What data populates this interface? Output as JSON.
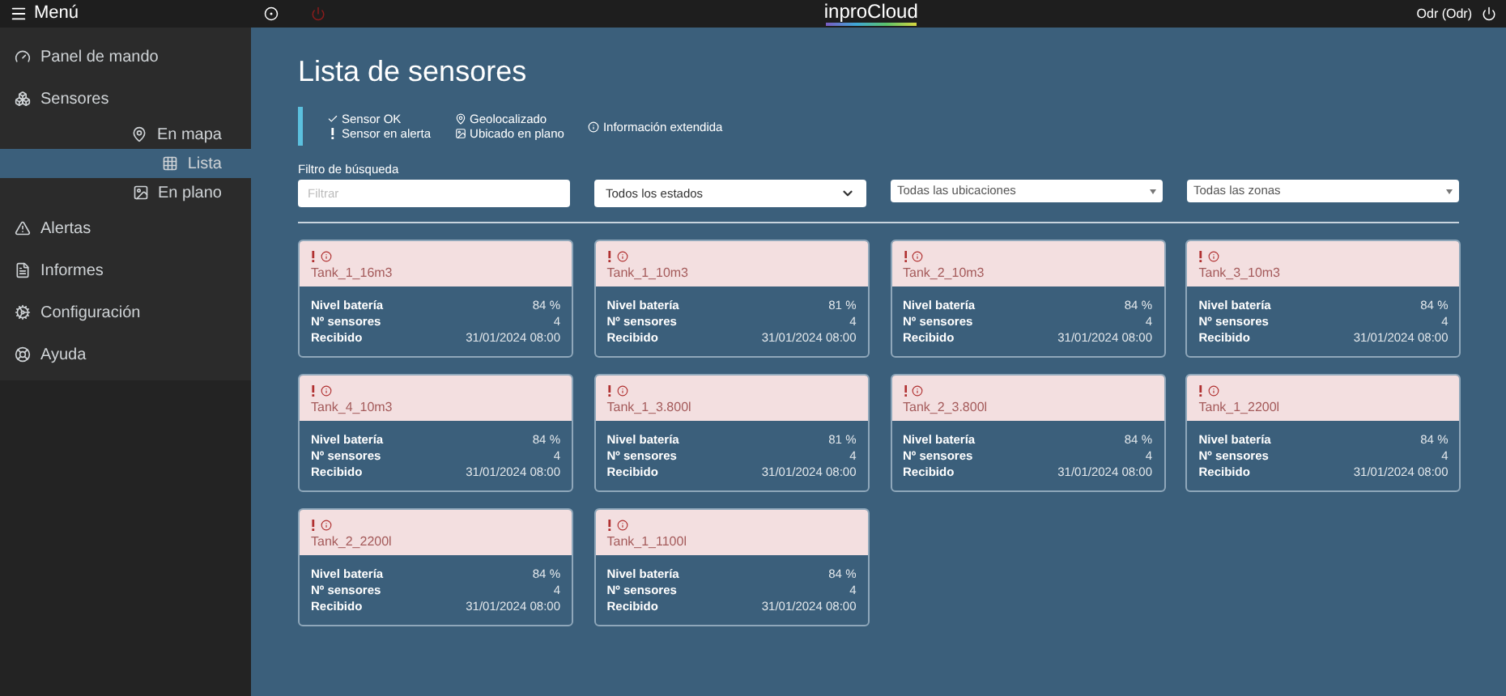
{
  "topbar": {
    "menu_label": "Menú",
    "logo": "inproCloud",
    "user": "Odr (Odr)"
  },
  "sidebar": {
    "items": [
      {
        "label": "Panel de mando",
        "selected": false
      },
      {
        "label": "Sensores",
        "selected": false,
        "children": [
          {
            "label": "En mapa",
            "selected": false
          },
          {
            "label": "Lista",
            "selected": true
          },
          {
            "label": "En plano",
            "selected": false
          }
        ]
      },
      {
        "label": "Alertas",
        "selected": false
      },
      {
        "label": "Informes",
        "selected": false
      },
      {
        "label": "Configuración",
        "selected": false
      },
      {
        "label": "Ayuda",
        "selected": false
      }
    ]
  },
  "page_title": "Lista de sensores",
  "legend": [
    [
      "Sensor OK",
      "Sensor en alerta"
    ],
    [
      "Geolocalizado",
      "Ubicado en plano"
    ],
    [
      "Información extendida"
    ]
  ],
  "filters": {
    "label": "Filtro de búsqueda",
    "search_placeholder": "Filtrar",
    "selects": [
      {
        "value": "Todos los estados",
        "kind": "native"
      },
      {
        "value": "Todas las ubicaciones",
        "kind": "custom"
      },
      {
        "value": "Todas las zonas",
        "kind": "custom"
      }
    ]
  },
  "sensors": [
    {
      "name": "Tank_1_16m3",
      "alert": true,
      "info": true,
      "rows": [
        [
          "Nivel batería",
          "84 %"
        ],
        [
          "Nº sensores",
          "4"
        ],
        [
          "Recibido",
          "31/01/2024 08:00"
        ]
      ]
    },
    {
      "name": "Tank_1_10m3",
      "alert": true,
      "info": true,
      "rows": [
        [
          "Nivel batería",
          "81 %"
        ],
        [
          "Nº sensores",
          "4"
        ],
        [
          "Recibido",
          "31/01/2024 08:00"
        ]
      ]
    },
    {
      "name": "Tank_2_10m3",
      "alert": true,
      "info": true,
      "rows": [
        [
          "Nivel batería",
          "84 %"
        ],
        [
          "Nº sensores",
          "4"
        ],
        [
          "Recibido",
          "31/01/2024 08:00"
        ]
      ]
    },
    {
      "name": "Tank_3_10m3",
      "alert": true,
      "info": true,
      "rows": [
        [
          "Nivel batería",
          "84 %"
        ],
        [
          "Nº sensores",
          "4"
        ],
        [
          "Recibido",
          "31/01/2024 08:00"
        ]
      ]
    },
    {
      "name": "Tank_4_10m3",
      "alert": true,
      "info": true,
      "rows": [
        [
          "Nivel batería",
          "84 %"
        ],
        [
          "Nº sensores",
          "4"
        ],
        [
          "Recibido",
          "31/01/2024 08:00"
        ]
      ]
    },
    {
      "name": "Tank_1_3.800l",
      "alert": true,
      "info": true,
      "rows": [
        [
          "Nivel batería",
          "81 %"
        ],
        [
          "Nº sensores",
          "4"
        ],
        [
          "Recibido",
          "31/01/2024 08:00"
        ]
      ]
    },
    {
      "name": "Tank_2_3.800l",
      "alert": true,
      "info": true,
      "rows": [
        [
          "Nivel batería",
          "84 %"
        ],
        [
          "Nº sensores",
          "4"
        ],
        [
          "Recibido",
          "31/01/2024 08:00"
        ]
      ]
    },
    {
      "name": "Tank_1_2200l",
      "alert": true,
      "info": true,
      "rows": [
        [
          "Nivel batería",
          "84 %"
        ],
        [
          "Nº sensores",
          "4"
        ],
        [
          "Recibido",
          "31/01/2024 08:00"
        ]
      ]
    },
    {
      "name": "Tank_2_2200l",
      "alert": true,
      "info": true,
      "rows": [
        [
          "Nivel batería",
          "84 %"
        ],
        [
          "Nº sensores",
          "4"
        ],
        [
          "Recibido",
          "31/01/2024 08:00"
        ]
      ]
    },
    {
      "name": "Tank_1_1100l",
      "alert": true,
      "info": true,
      "rows": [
        [
          "Nivel batería",
          "84 %"
        ],
        [
          "Nº sensores",
          "4"
        ],
        [
          "Recibido",
          "31/01/2024 08:00"
        ]
      ]
    }
  ]
}
